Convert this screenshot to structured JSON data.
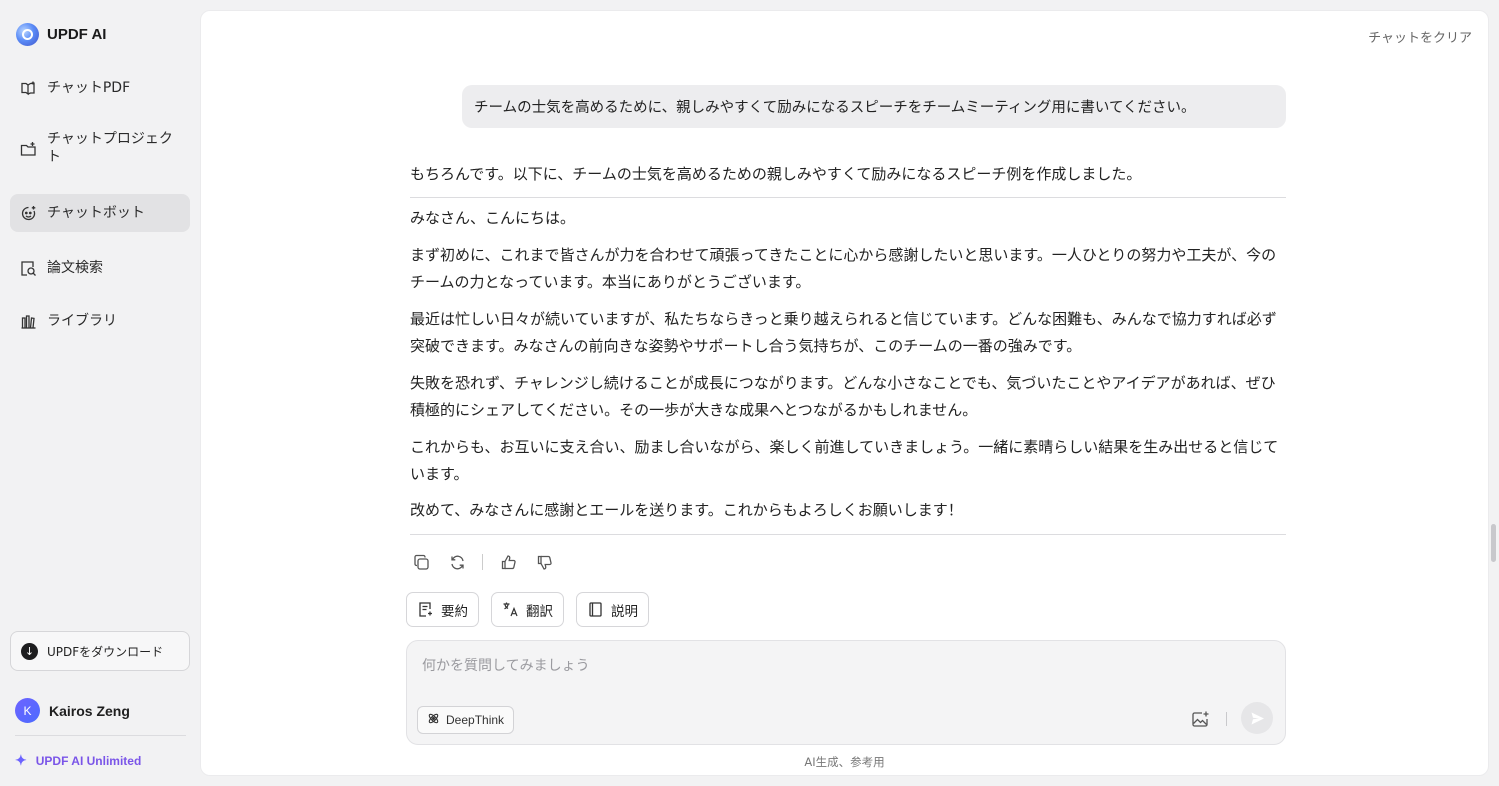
{
  "app": {
    "name": "UPDF AI"
  },
  "sidebar": {
    "items": [
      {
        "label": "チャットPDF",
        "icon": "chat-pdf-icon"
      },
      {
        "label": "チャットプロジェクト",
        "icon": "folder-plus-icon"
      },
      {
        "label": "チャットボット",
        "icon": "bot-icon",
        "active": true
      },
      {
        "label": "論文検索",
        "icon": "paper-search-icon"
      },
      {
        "label": "ライブラリ",
        "icon": "library-icon"
      }
    ],
    "download_label": "UPDFをダウンロード",
    "user": {
      "initial": "K",
      "name": "Kairos Zeng"
    },
    "plan_label": "UPDF AI Unlimited"
  },
  "main": {
    "clear_chat": "チャットをクリア",
    "user_message": "チームの士気を高めるために、親しみやすくて励みになるスピーチをチームミーティング用に書いてください。",
    "answer": {
      "intro": "もちろんです。以下に、チームの士気を高めるための親しみやすくて励みになるスピーチ例を作成しました。",
      "paragraphs": [
        "みなさん、こんにちは。",
        "まず初めに、これまで皆さんが力を合わせて頑張ってきたことに心から感謝したいと思います。一人ひとりの努力や工夫が、今のチームの力となっています。本当にありがとうございます。",
        "最近は忙しい日々が続いていますが、私たちならきっと乗り越えられると信じています。どんな困難も、みんなで協力すれば必ず突破できます。みなさんの前向きな姿勢やサポートし合う気持ちが、このチームの一番の強みです。",
        "失敗を恐れず、チャレンジし続けることが成長につながります。どんな小さなことでも、気づいたことやアイデアがあれば、ぜひ積極的にシェアしてください。その一歩が大きな成果へとつながるかもしれません。",
        "これからも、お互いに支え合い、励まし合いながら、楽しく前進していきましょう。一緒に素晴らしい結果を生み出せると信じています。",
        "改めて、みなさんに感謝とエールを送ります。これからもよろしくお願いします！"
      ]
    },
    "actions": [
      "copy-icon",
      "regenerate-icon",
      "thumbs-up-icon",
      "thumbs-down-icon"
    ],
    "chips": [
      {
        "label": "要約",
        "icon": "summary-icon"
      },
      {
        "label": "翻訳",
        "icon": "translate-icon"
      },
      {
        "label": "説明",
        "icon": "book-icon"
      }
    ],
    "composer": {
      "placeholder": "何かを質問してみましょう",
      "deepthink_label": "DeepThink"
    },
    "footer_note": "AI生成、参考用"
  }
}
